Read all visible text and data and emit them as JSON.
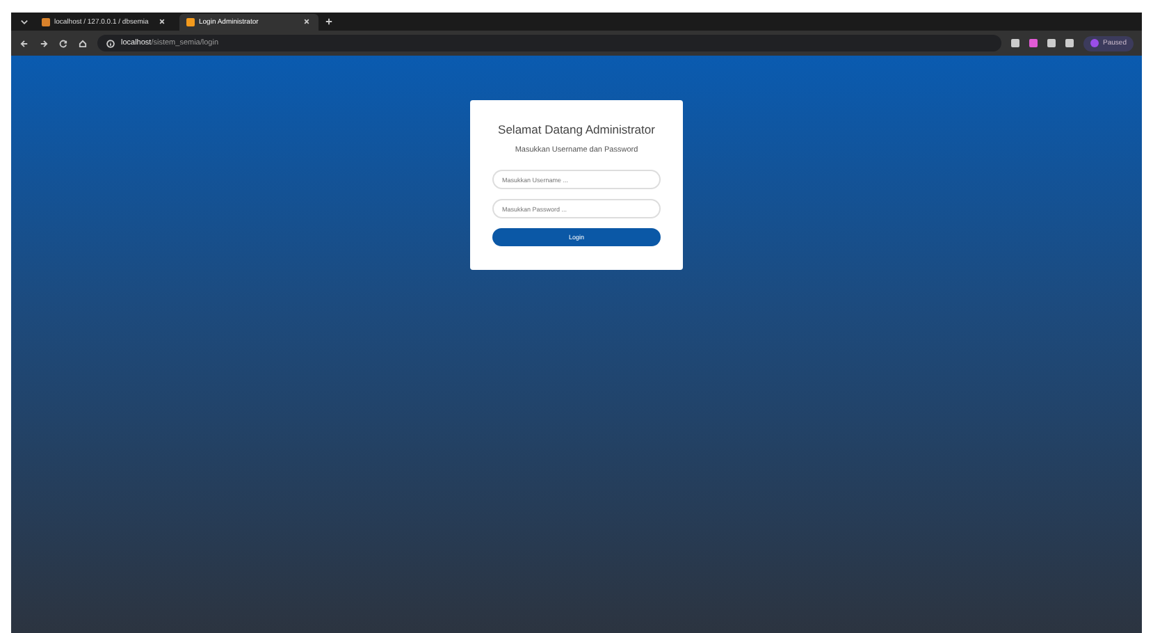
{
  "browser": {
    "tabs": [
      {
        "title": "localhost / 127.0.0.1 / dbsemia",
        "selected": false
      },
      {
        "title": "Login Administrator",
        "selected": true
      }
    ],
    "url_host": "localhost",
    "url_path": "/sistem_semia/login",
    "profile": "Paused"
  },
  "login": {
    "title": "Selamat Datang Administrator",
    "subtitle": "Masukkan Username dan Password",
    "username": {
      "placeholder": "Masukkan Username ..."
    },
    "password": {
      "placeholder": "Masukkan Password ..."
    },
    "button": "Login"
  }
}
